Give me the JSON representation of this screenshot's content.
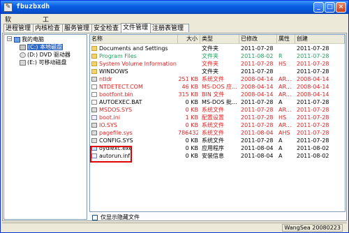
{
  "window": {
    "title": "fbuzbxdh",
    "title_icon": "app-icon",
    "buttons": [
      "minimize-icon",
      "maximize-icon",
      "close-icon"
    ],
    "button_glyphs": [
      "_",
      "□",
      "×"
    ]
  },
  "menu": [
    "软件设置(Z)",
    "工具(T)"
  ],
  "tabs": [
    "进程管理",
    "内核检查",
    "服务管理",
    "安全检查",
    "文件管理",
    "注册表管理"
  ],
  "active_tab": 4,
  "tree": {
    "root": "我的电脑",
    "drives": [
      {
        "label": "(C:) 本地磁盘",
        "selected": true
      },
      {
        "label": "(D:) DVD 驱动器",
        "selected": false
      },
      {
        "label": "(E:) 可移动磁盘",
        "selected": false
      }
    ]
  },
  "columns": [
    "名称",
    "大小",
    "类型",
    "已修改",
    "属性",
    "创建"
  ],
  "files": [
    {
      "name": "Documents and Settings",
      "size": "",
      "type": "文件夹",
      "modified": "2011-07-28",
      "attr": "",
      "created": "2011-07-28",
      "icon": "folder",
      "color": "normal"
    },
    {
      "name": "Program Files",
      "size": "",
      "type": "文件夹",
      "modified": "2011-08-02",
      "attr": "R",
      "created": "2011-07-28",
      "icon": "folder",
      "color": "green"
    },
    {
      "name": "System Volume Information",
      "size": "",
      "type": "文件夹",
      "modified": "2011-07-28",
      "attr": "HS",
      "created": "2011-07-28",
      "icon": "folder",
      "color": "red"
    },
    {
      "name": "WINDOWS",
      "size": "",
      "type": "文件夹",
      "modified": "2011-07-28",
      "attr": "",
      "created": "2011-07-28",
      "icon": "folder",
      "color": "normal"
    },
    {
      "name": "ntldr",
      "size": "251 KB",
      "type": "系统文件",
      "modified": "2008-04-14",
      "attr": "AR...",
      "created": "2008-04-14",
      "icon": "sys",
      "color": "red"
    },
    {
      "name": "NTDETECT.COM",
      "size": "46 KB",
      "type": "MS-DOS 应...",
      "modified": "2008-04-14",
      "attr": "AR...",
      "created": "2008-04-14",
      "icon": "file",
      "color": "red"
    },
    {
      "name": "bootfont.bin",
      "size": "315 KB",
      "type": "BIN 文件",
      "modified": "2008-04-14",
      "attr": "AR...",
      "created": "2008-04-14",
      "icon": "file",
      "color": "red"
    },
    {
      "name": "AUTOEXEC.BAT",
      "size": "0 KB",
      "type": "MS-DOS 批...",
      "modified": "2011-07-28",
      "attr": "A",
      "created": "2011-07-28",
      "icon": "file",
      "color": "normal"
    },
    {
      "name": "MSDOS.SYS",
      "size": "0 KB",
      "type": "系统文件",
      "modified": "2011-07-28",
      "attr": "AR...",
      "created": "2011-07-28",
      "icon": "sys",
      "color": "red"
    },
    {
      "name": "boot.ini",
      "size": "1 KB",
      "type": "配置设置",
      "modified": "2011-07-28",
      "attr": "HS",
      "created": "2011-07-28",
      "icon": "ini",
      "color": "red"
    },
    {
      "name": "IO.SYS",
      "size": "0 KB",
      "type": "系统文件",
      "modified": "2011-07-28",
      "attr": "AR...",
      "created": "2011-07-28",
      "icon": "sys",
      "color": "red"
    },
    {
      "name": "pagefile.sys",
      "size": "786432 KB",
      "type": "系统文件",
      "modified": "2011-08-04",
      "attr": "AHS",
      "created": "2011-07-28",
      "icon": "sys",
      "color": "red"
    },
    {
      "name": "CONFIG.SYS",
      "size": "0 KB",
      "type": "系统文件",
      "modified": "2011-07-28",
      "attr": "A",
      "created": "2011-07-28",
      "icon": "sys",
      "color": "normal"
    },
    {
      "name": "oydlexc.exe",
      "size": "0 KB",
      "type": "应用程序",
      "modified": "2011-08-04",
      "attr": "A",
      "created": "2011-08-02",
      "icon": "exe",
      "color": "normal"
    },
    {
      "name": "autorun.inf",
      "size": "0 KB",
      "type": "安装信息",
      "modified": "2011-08-04",
      "attr": "A",
      "created": "2011-08-02",
      "icon": "ini",
      "color": "normal"
    }
  ],
  "show_hidden": {
    "label": "仅显示隐藏文件",
    "checked": false
  },
  "status": "WangSea 20080223",
  "colors": {
    "red": "#e02020",
    "green": "#20a060",
    "selection": "#316ac5",
    "titlebar": "#0554d6"
  }
}
